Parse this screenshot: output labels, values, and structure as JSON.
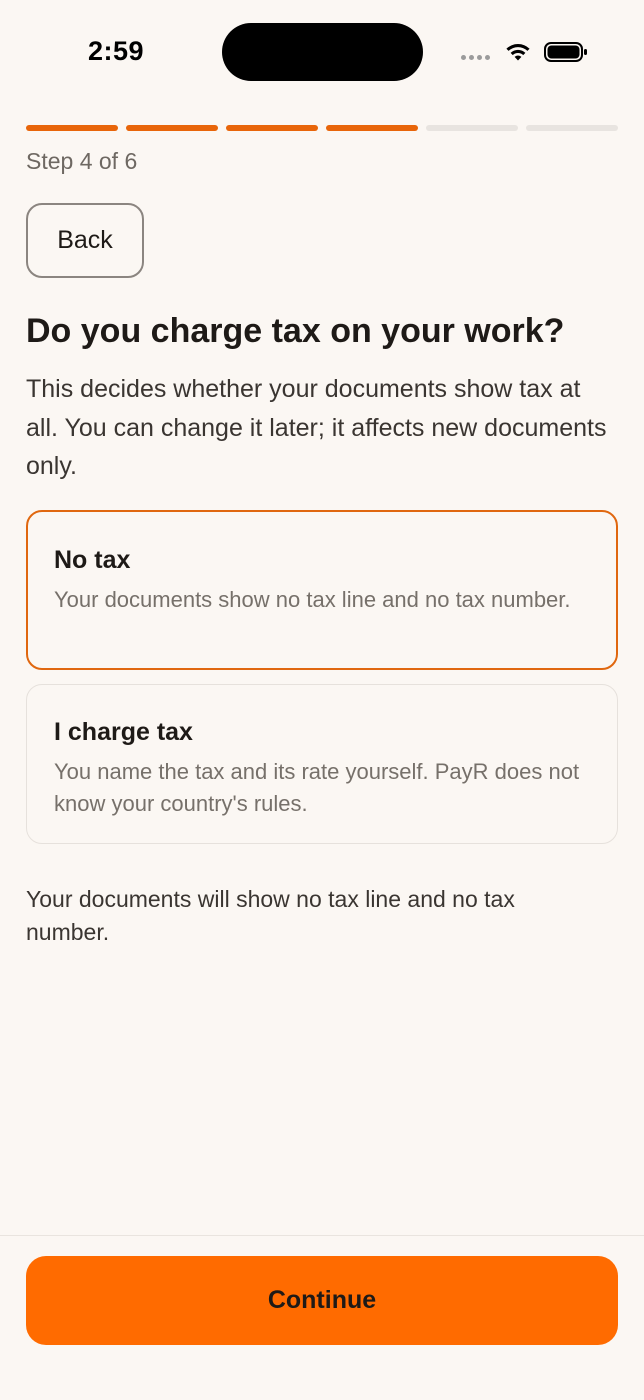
{
  "status_bar": {
    "time": "2:59"
  },
  "progress": {
    "current_step": 4,
    "total_steps": 6,
    "label": "Step 4 of 6"
  },
  "nav": {
    "back_label": "Back"
  },
  "question": {
    "title": "Do you charge tax on your work?",
    "intro": "This decides whether your documents show tax at all. You can change it later; it affects new documents only."
  },
  "options": [
    {
      "title": "No tax",
      "description": "Your documents show no tax line and no tax number.",
      "selected": true
    },
    {
      "title": "I charge tax",
      "description": "You name the tax and its rate yourself. PayR does not know your country's rules.",
      "selected": false
    }
  ],
  "summary": "Your documents will show no tax line and no tax number.",
  "footer": {
    "continue_label": "Continue"
  },
  "colors": {
    "accent": "#E8650A",
    "button": "#FF6B00",
    "background": "#FBF7F3"
  }
}
